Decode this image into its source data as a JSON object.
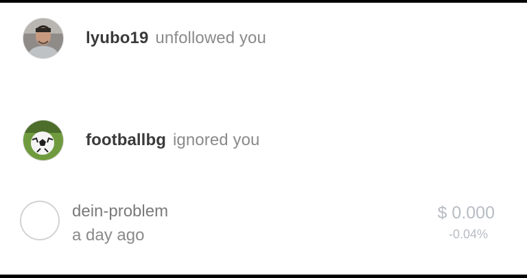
{
  "notifications": [
    {
      "username": "lyubo19",
      "action": "unfollowed you",
      "avatar_icon": "user-photo-avatar"
    },
    {
      "username": "footballbg",
      "action": "ignored you",
      "avatar_icon": "soccer-ball-avatar"
    }
  ],
  "transaction": {
    "name": "dein-problem",
    "time": "a day ago",
    "amount": "$ 0.000",
    "change": "-0.04%"
  },
  "colors": {
    "username": "#3a3a3a",
    "action": "#8a8a8a",
    "value": "#b7bcc4",
    "background": "#ffffff"
  }
}
